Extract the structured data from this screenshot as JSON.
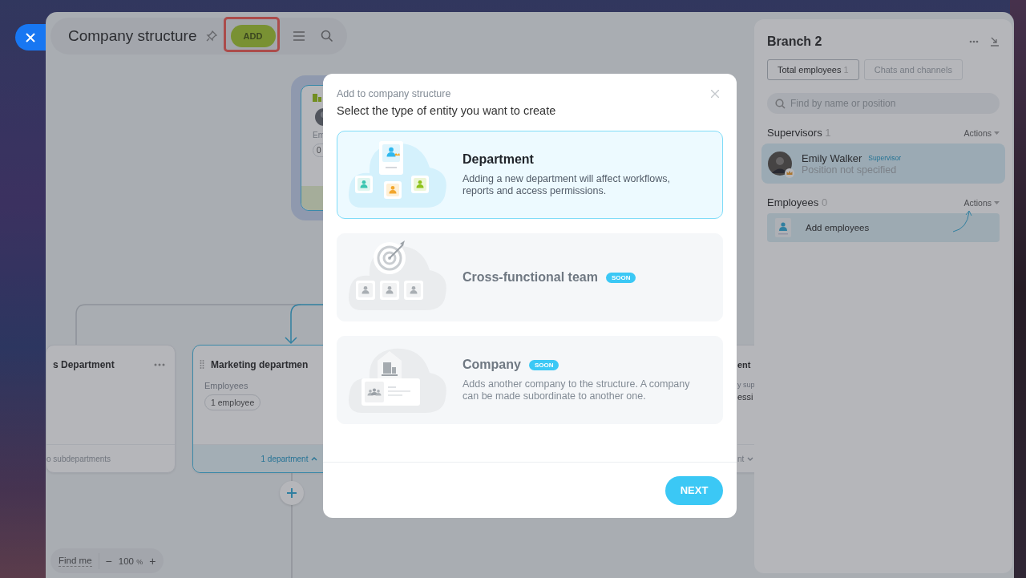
{
  "header": {
    "title": "Company structure",
    "add_button": {
      "label": "ADD",
      "highlighted": true
    }
  },
  "root_node": {
    "label": "Em",
    "chip": "0"
  },
  "departments": [
    {
      "title": "s Department",
      "footer": "o subdepartments",
      "selected": false,
      "has_menu": true
    },
    {
      "title": "Marketing departmen",
      "label": "Employees",
      "chip": "1 employee",
      "footer": "1 department",
      "selected": true,
      "expanded": true
    },
    {
      "title": "ent",
      "label": "y sup",
      "value": "essi",
      "footer": "nt",
      "selected": false,
      "expanded": false
    }
  ],
  "zoom_bar": {
    "find_me": "Find me",
    "minus": "−",
    "value": "100",
    "unit": "%",
    "plus": "+"
  },
  "side_panel": {
    "title": "Branch 2",
    "tabs": [
      {
        "label": "Total employees",
        "count": "1",
        "selected": true
      },
      {
        "label": "Chats and channels",
        "selected": false
      }
    ],
    "search": {
      "placeholder": "Find by name or position"
    },
    "supervisors": {
      "title": "Supervisors",
      "count": "1",
      "actions": "Actions",
      "people": [
        {
          "name": "Emily Walker",
          "badge": "Supervisor",
          "position": "Position not specified"
        }
      ]
    },
    "employees": {
      "title": "Employees",
      "count": "0",
      "actions": "Actions",
      "add_label": "Add employees"
    }
  },
  "dialog": {
    "subtitle": "Add to company structure",
    "title": "Select the type of entity you want to create",
    "options": [
      {
        "kind": "department",
        "title": "Department",
        "description": "Adding a new department will affect workflows, reports and access permissions.",
        "selected": true,
        "disabled": false
      },
      {
        "kind": "team",
        "title": "Cross-functional team",
        "badge": "SOON",
        "selected": false,
        "disabled": true
      },
      {
        "kind": "company",
        "title": "Company",
        "badge": "SOON",
        "description": "Adds another company to the structure. A company can be made subordinate to another one.",
        "selected": false,
        "disabled": true
      }
    ],
    "next_button": "NEXT"
  }
}
